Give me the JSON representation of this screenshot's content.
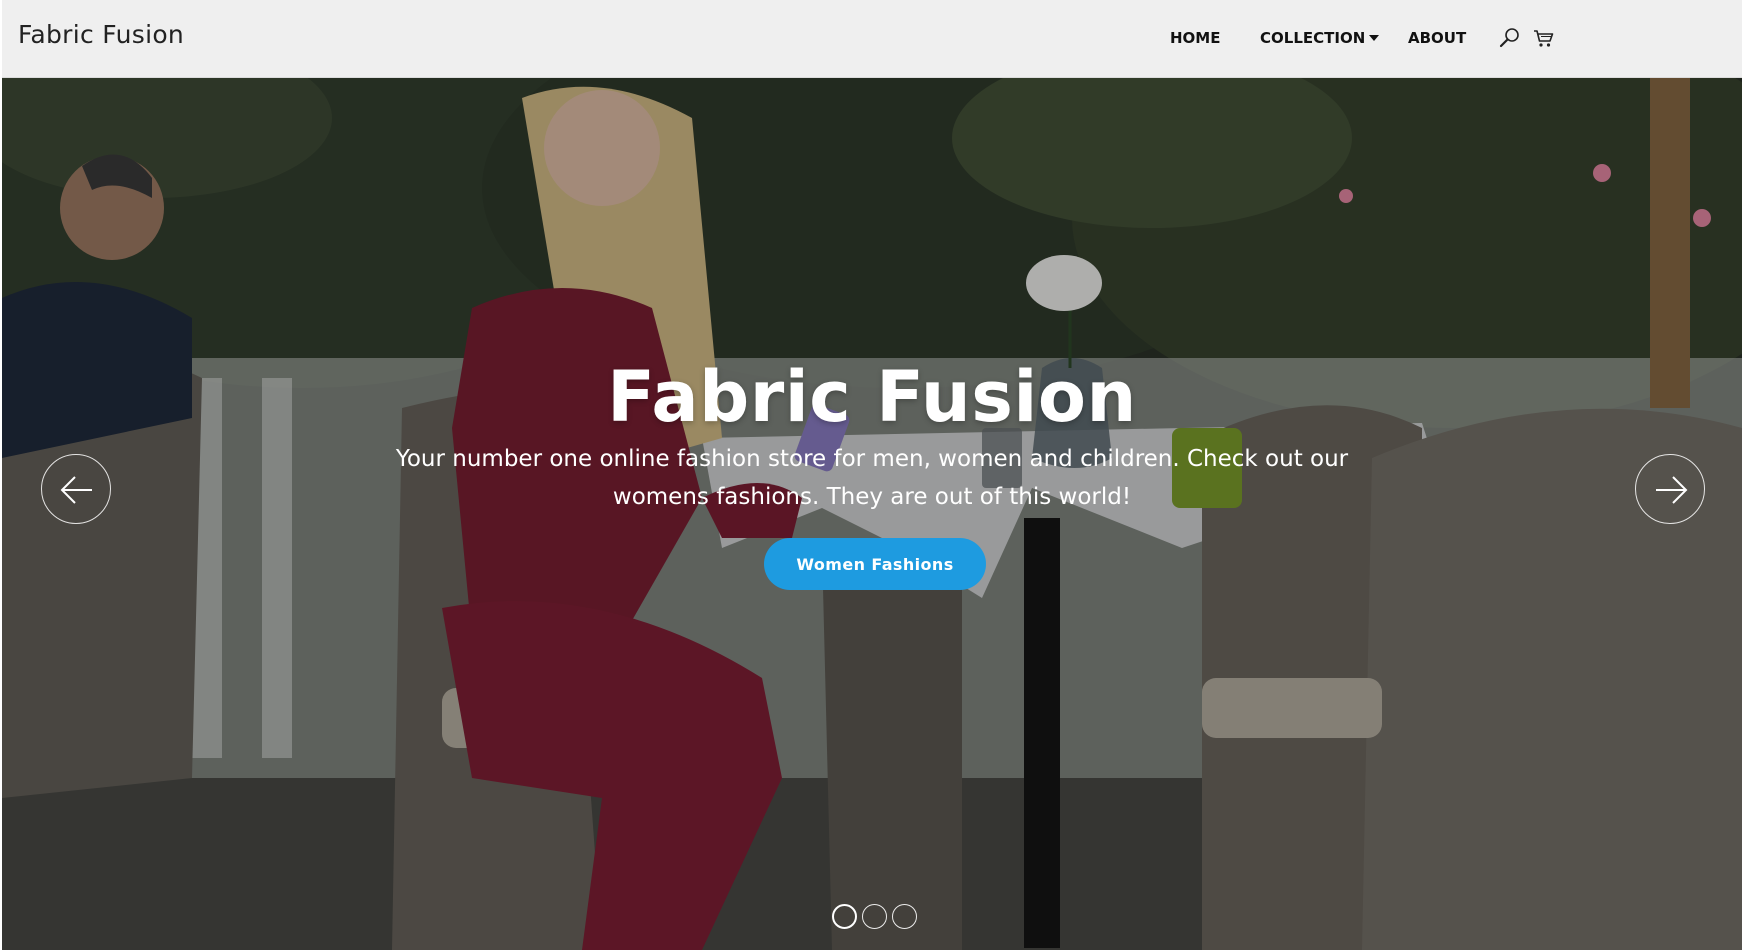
{
  "navbar": {
    "brand": "Fabric Fusion",
    "links": [
      {
        "label": "HOME"
      },
      {
        "label": "COLLECTION",
        "has_dropdown": true
      },
      {
        "label": "ABOUT"
      }
    ],
    "icons": [
      "search-icon",
      "cart-icon"
    ]
  },
  "hero": {
    "title": "Fabric Fusion",
    "subtitle": "Your number one online fashion store for men, women and children. Check out our womens fashions. They are out of this world!",
    "button_label": "Women Fashions",
    "carousel": {
      "slide_count": 3,
      "active_index": 0,
      "prev_icon": "arrow-left-icon",
      "next_icon": "arrow-right-icon"
    }
  },
  "colors": {
    "accent": "#1e9be0",
    "navbar_bg": "#efefef",
    "text_dark": "#111111",
    "text_light": "#ffffff"
  }
}
